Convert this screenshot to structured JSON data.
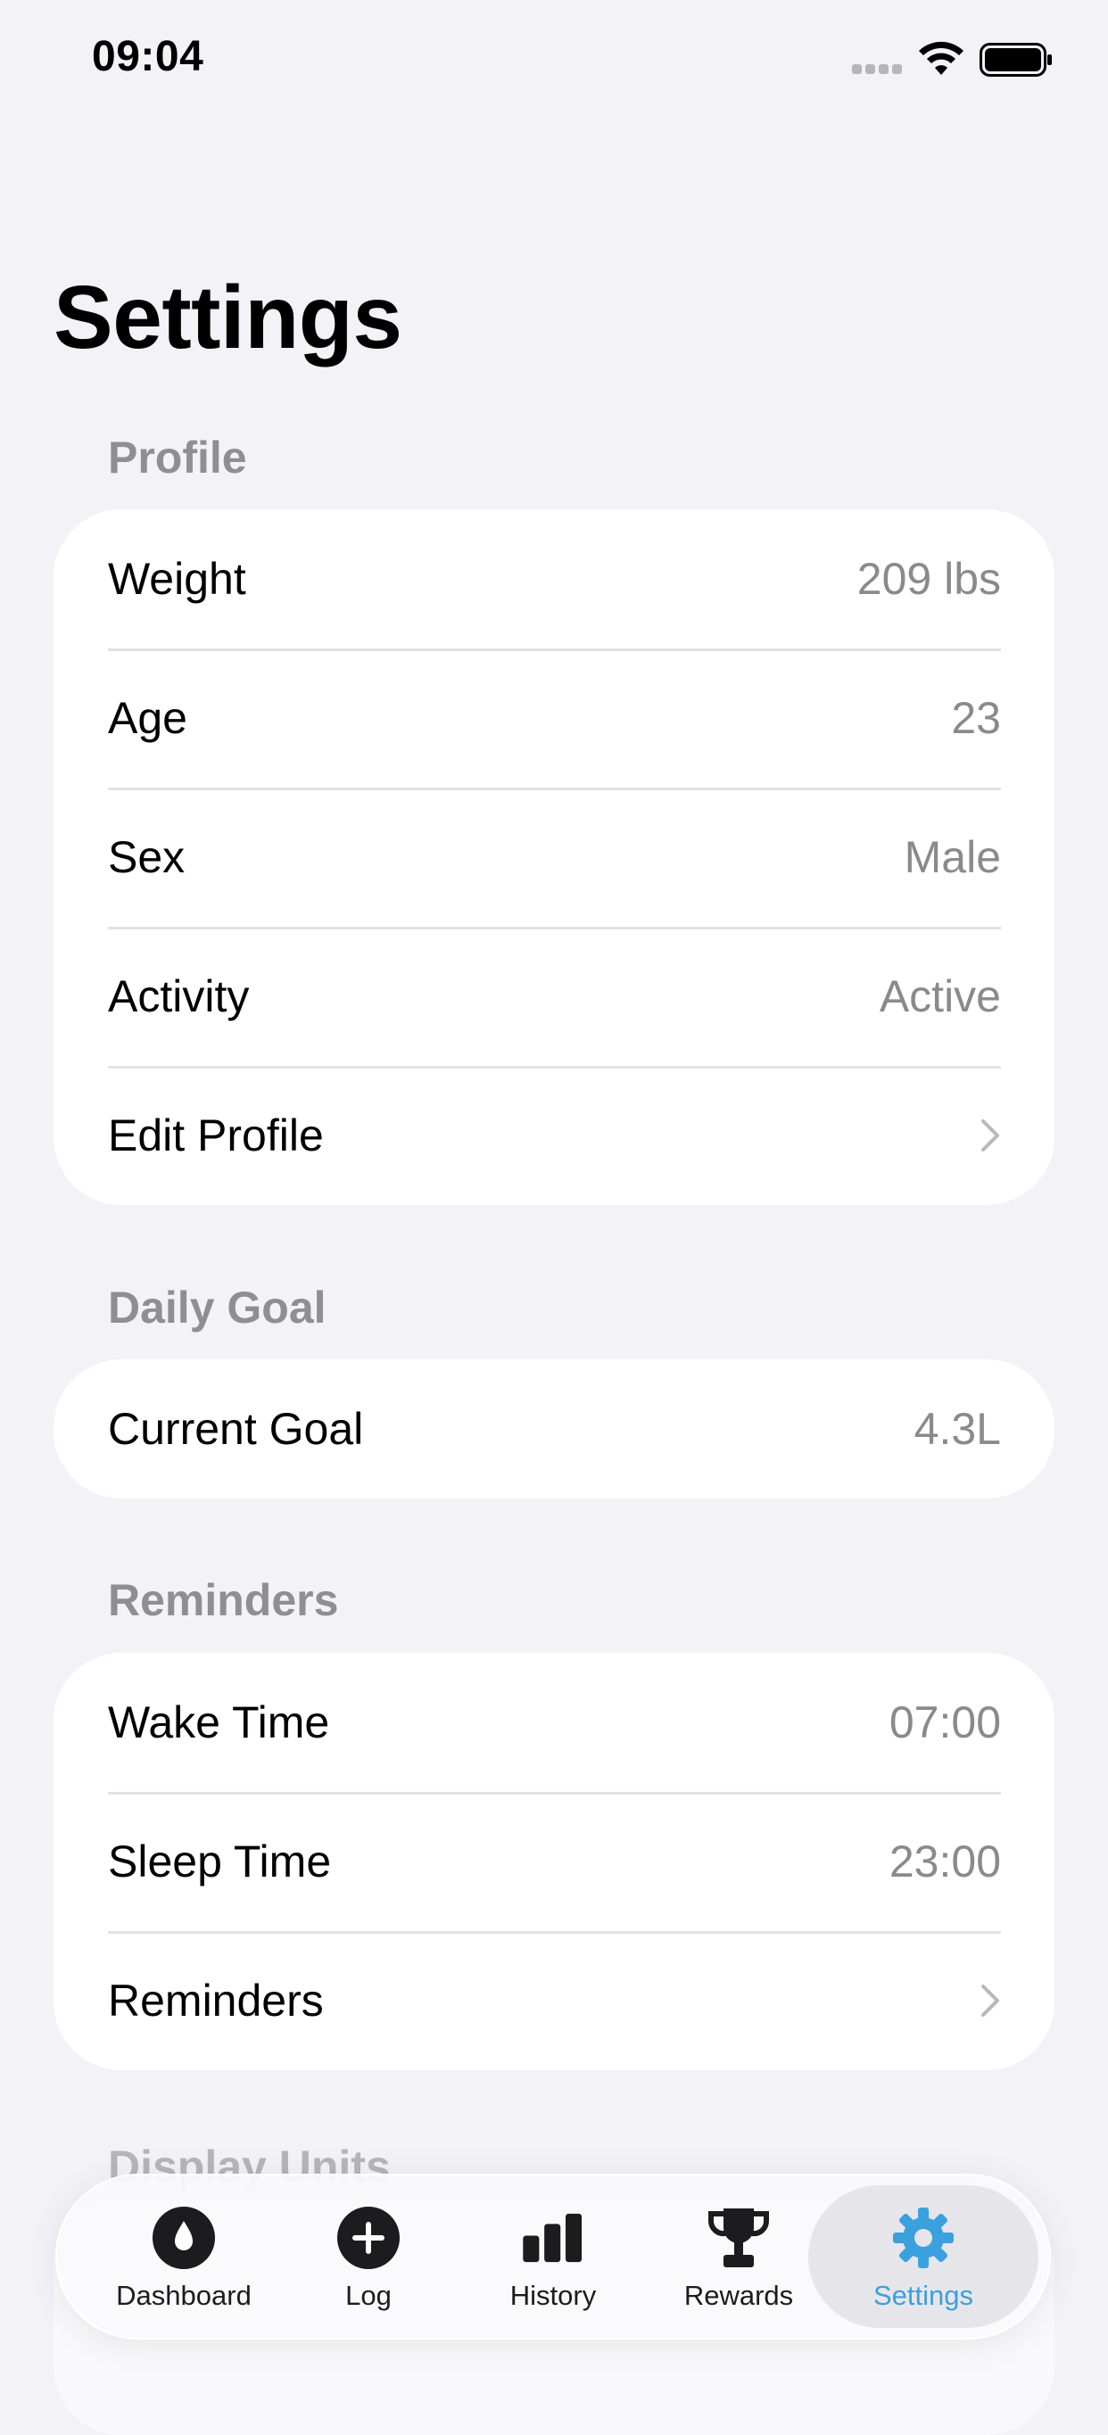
{
  "status_bar": {
    "time": "09:04"
  },
  "header": {
    "title": "Settings"
  },
  "profile": {
    "header": "Profile",
    "rows": [
      {
        "label": "Weight",
        "value": "209 lbs"
      },
      {
        "label": "Age",
        "value": "23"
      },
      {
        "label": "Sex",
        "value": "Male"
      },
      {
        "label": "Activity",
        "value": "Active"
      }
    ],
    "edit_label": "Edit Profile"
  },
  "daily_goal": {
    "header": "Daily Goal",
    "label": "Current Goal",
    "value": "4.3L"
  },
  "reminders": {
    "header": "Reminders",
    "wake_label": "Wake Time",
    "wake_value": "07:00",
    "sleep_label": "Sleep Time",
    "sleep_value": "23:00",
    "link_label": "Reminders"
  },
  "display_units": {
    "header": "Display Units"
  },
  "tab_bar": {
    "tabs": [
      {
        "label": "Dashboard",
        "icon": "water-drop-icon"
      },
      {
        "label": "Log",
        "icon": "plus-circle-icon"
      },
      {
        "label": "History",
        "icon": "bar-chart-icon"
      },
      {
        "label": "Rewards",
        "icon": "trophy-icon"
      },
      {
        "label": "Settings",
        "icon": "gear-icon"
      }
    ],
    "active_index": 4,
    "accent_color": "#3aa0de"
  }
}
